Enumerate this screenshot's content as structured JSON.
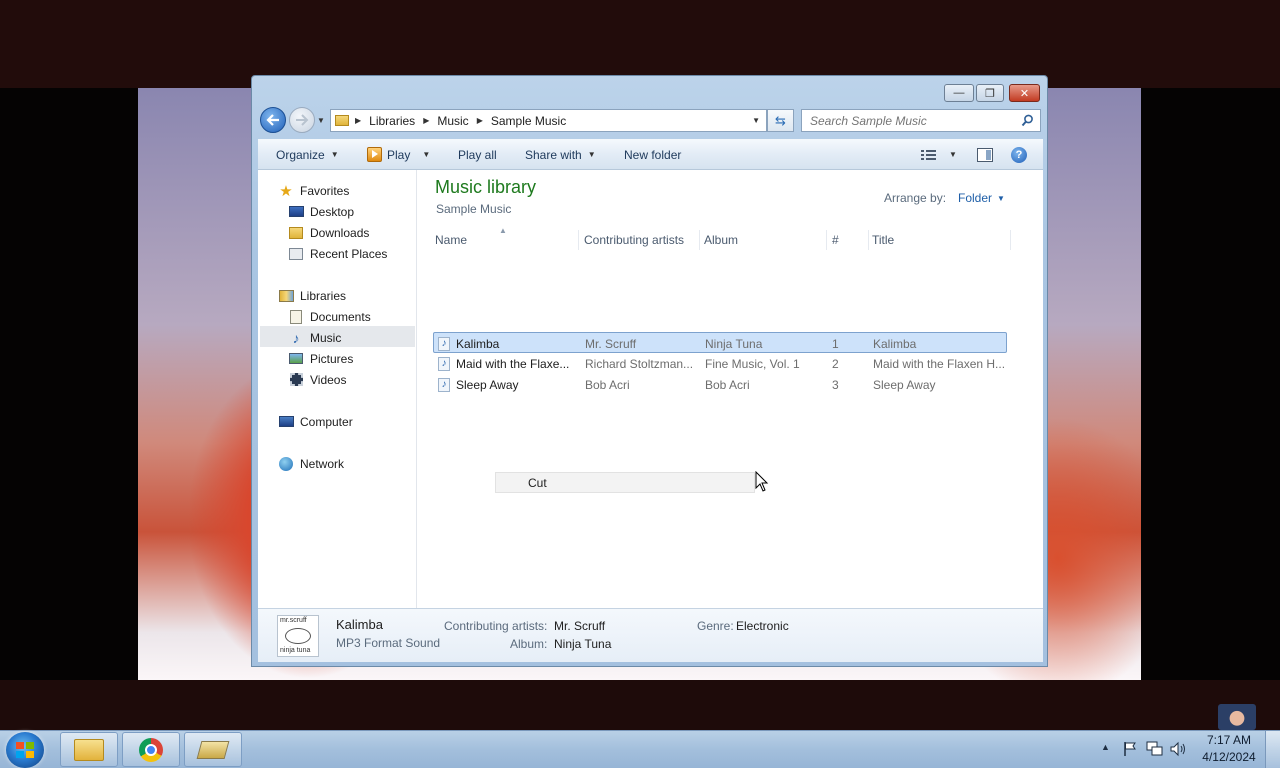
{
  "window": {
    "minimize_glyph": "—",
    "maximize_glyph": "❐",
    "close_glyph": "✕"
  },
  "address": {
    "crumbs": [
      "Libraries",
      "Music",
      "Sample Music"
    ],
    "search_placeholder": "Search Sample Music"
  },
  "toolbar": {
    "organize": "Organize",
    "play": "Play",
    "play_all": "Play all",
    "share_with": "Share with",
    "new_folder": "New folder"
  },
  "nav": {
    "favorites": "Favorites",
    "desktop": "Desktop",
    "downloads": "Downloads",
    "recent_places": "Recent Places",
    "libraries": "Libraries",
    "documents": "Documents",
    "music": "Music",
    "pictures": "Pictures",
    "videos": "Videos",
    "computer": "Computer",
    "network": "Network"
  },
  "library": {
    "title": "Music library",
    "subtitle": "Sample Music",
    "arrange_label": "Arrange by:",
    "arrange_value": "Folder"
  },
  "columns": {
    "name": "Name",
    "artists": "Contributing artists",
    "album": "Album",
    "number": "#",
    "title": "Title"
  },
  "rows": [
    {
      "name": "Kalimba",
      "artist": "Mr. Scruff",
      "album": "Ninja Tuna",
      "number": "1",
      "title": "Kalimba"
    },
    {
      "name": "Maid with the Flaxe...",
      "artist": "Richard Stoltzman...",
      "album": "Fine Music, Vol. 1",
      "number": "2",
      "title": "Maid with the Flaxen H..."
    },
    {
      "name": "Sleep Away",
      "artist": "Bob Acri",
      "album": "Bob Acri",
      "number": "3",
      "title": "Sleep Away"
    }
  ],
  "context_menu": {
    "cut": "Cut"
  },
  "details": {
    "name": "Kalimba",
    "type": "MP3 Format Sound",
    "artists_label": "Contributing artists:",
    "artists_value": "Mr. Scruff",
    "album_label": "Album:",
    "album_value": "Ninja Tuna",
    "genre_label": "Genre:",
    "genre_value": "Electronic",
    "art_line1": "mr.scruff",
    "art_line2": "ninja tuna"
  },
  "clock": {
    "time": "7:17 AM",
    "date": "4/12/2024"
  },
  "colors": {
    "accent_title": "#1e7a1e",
    "selection": "#cde2fa",
    "link": "#1f5fa8"
  }
}
